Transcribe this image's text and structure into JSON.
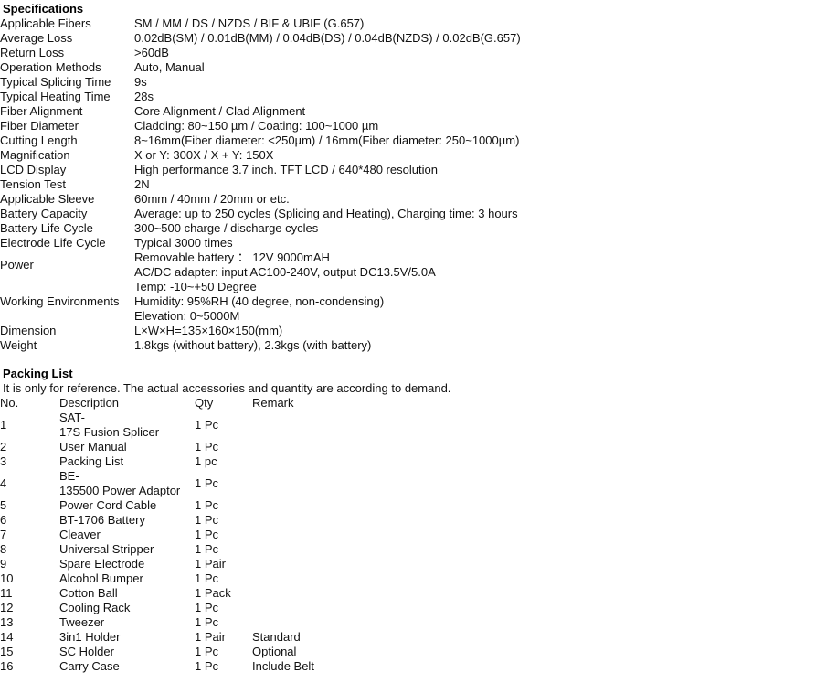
{
  "specifications": {
    "heading": "Specifications",
    "rows": [
      {
        "label": "Applicable Fibers",
        "values": [
          "SM / MM / DS / NZDS / BIF & UBIF (G.657)"
        ]
      },
      {
        "label": "Average Loss",
        "values": [
          "0.02dB(SM) / 0.01dB(MM) / 0.04dB(DS) / 0.04dB(NZDS) / 0.02dB(G.657)"
        ]
      },
      {
        "label": "Return Loss",
        "values": [
          ">60dB"
        ]
      },
      {
        "label": "Operation Methods",
        "values": [
          "Auto, Manual"
        ]
      },
      {
        "label": "Typical Splicing Time",
        "values": [
          "9s"
        ]
      },
      {
        "label": "Typical Heating Time",
        "values": [
          "28s"
        ]
      },
      {
        "label": "Fiber Alignment",
        "values": [
          "Core Alignment / Clad Alignment"
        ]
      },
      {
        "label": "Fiber Diameter",
        "values": [
          "Cladding: 80~150 µm / Coating: 100~1000 µm"
        ]
      },
      {
        "label": "Cutting Length",
        "values": [
          "8~16mm(Fiber diameter: <250µm) / 16mm(Fiber diameter: 250~1000µm)"
        ]
      },
      {
        "label": "Magnification",
        "values": [
          "X or Y: 300X  /   X + Y: 150X"
        ]
      },
      {
        "label": "LCD Display",
        "values": [
          "High performance 3.7 inch. TFT LCD / 640*480 resolution"
        ]
      },
      {
        "label": "Tension Test",
        "values": [
          "2N"
        ]
      },
      {
        "label": "Applicable Sleeve",
        "values": [
          "60mm / 40mm / 20mm or etc."
        ]
      },
      {
        "label": "Battery Capacity",
        "values": [
          "Average: up to 250 cycles (Splicing and Heating), Charging time: 3 hours"
        ]
      },
      {
        "label": "Battery Life Cycle",
        "values": [
          "300~500 charge / discharge cycles"
        ]
      },
      {
        "label": "Electrode Life Cycle",
        "values": [
          "Typical 3000 times"
        ]
      },
      {
        "label": "Power",
        "values": [
          "Removable battery ：  12V 9000mAH",
          "AC/DC adapter: input AC100-240V, output DC13.5V/5.0A"
        ]
      },
      {
        "label": "Working Environments",
        "values": [
          "Temp: -10~+50 Degree",
          "Humidity: 95%RH (40 degree, non-condensing)",
          "Elevation: 0~5000M"
        ]
      },
      {
        "label": "Dimension",
        "values": [
          "L×W×H=135×160×150(mm)"
        ]
      },
      {
        "label": "Weight",
        "values": [
          "1.8kgs (without battery), 2.3kgs (with battery)"
        ]
      }
    ]
  },
  "packing_list": {
    "heading": "Packing List",
    "note": "It is only for reference. The actual accessories and quantity are according to demand.",
    "columns": [
      "No.",
      "Description",
      "Qty",
      "Remark"
    ],
    "rows": [
      {
        "no": "1",
        "description": "SAT-17S Fusion Splicer",
        "qty": "1 Pc",
        "remark": ""
      },
      {
        "no": "2",
        "description": "User Manual",
        "qty": "1 Pc",
        "remark": ""
      },
      {
        "no": "3",
        "description": "Packing List",
        "qty": "1 pc",
        "remark": ""
      },
      {
        "no": "4",
        "description": "BE-135500 Power Adaptor",
        "qty": "1 Pc",
        "remark": ""
      },
      {
        "no": "5",
        "description": "Power Cord Cable",
        "qty": "1 Pc",
        "remark": ""
      },
      {
        "no": "6",
        "description": "BT-1706 Battery",
        "qty": "1 Pc",
        "remark": ""
      },
      {
        "no": "7",
        "description": "Cleaver",
        "qty": "1 Pc",
        "remark": ""
      },
      {
        "no": "8",
        "description": "Universal Stripper",
        "qty": "1 Pc",
        "remark": ""
      },
      {
        "no": "9",
        "description": "Spare Electrode",
        "qty": "1 Pair",
        "remark": ""
      },
      {
        "no": "10",
        "description": "Alcohol Bumper",
        "qty": "1 Pc",
        "remark": ""
      },
      {
        "no": "11",
        "description": "Cotton Ball",
        "qty": "1 Pack",
        "remark": ""
      },
      {
        "no": "12",
        "description": "Cooling Rack",
        "qty": "1 Pc",
        "remark": ""
      },
      {
        "no": "13",
        "description": "Tweezer",
        "qty": "1 Pc",
        "remark": ""
      },
      {
        "no": "14",
        "description": "3in1 Holder",
        "qty": "1 Pair",
        "remark": "Standard"
      },
      {
        "no": "15",
        "description": "SC Holder",
        "qty": "1 Pc",
        "remark": "Optional"
      },
      {
        "no": "16",
        "description": "Carry Case",
        "qty": "1 Pc",
        "remark": "Include Belt"
      }
    ]
  },
  "colors": {
    "text": "#111111",
    "background": "#ffffff",
    "rule": "#e2e2e2"
  }
}
